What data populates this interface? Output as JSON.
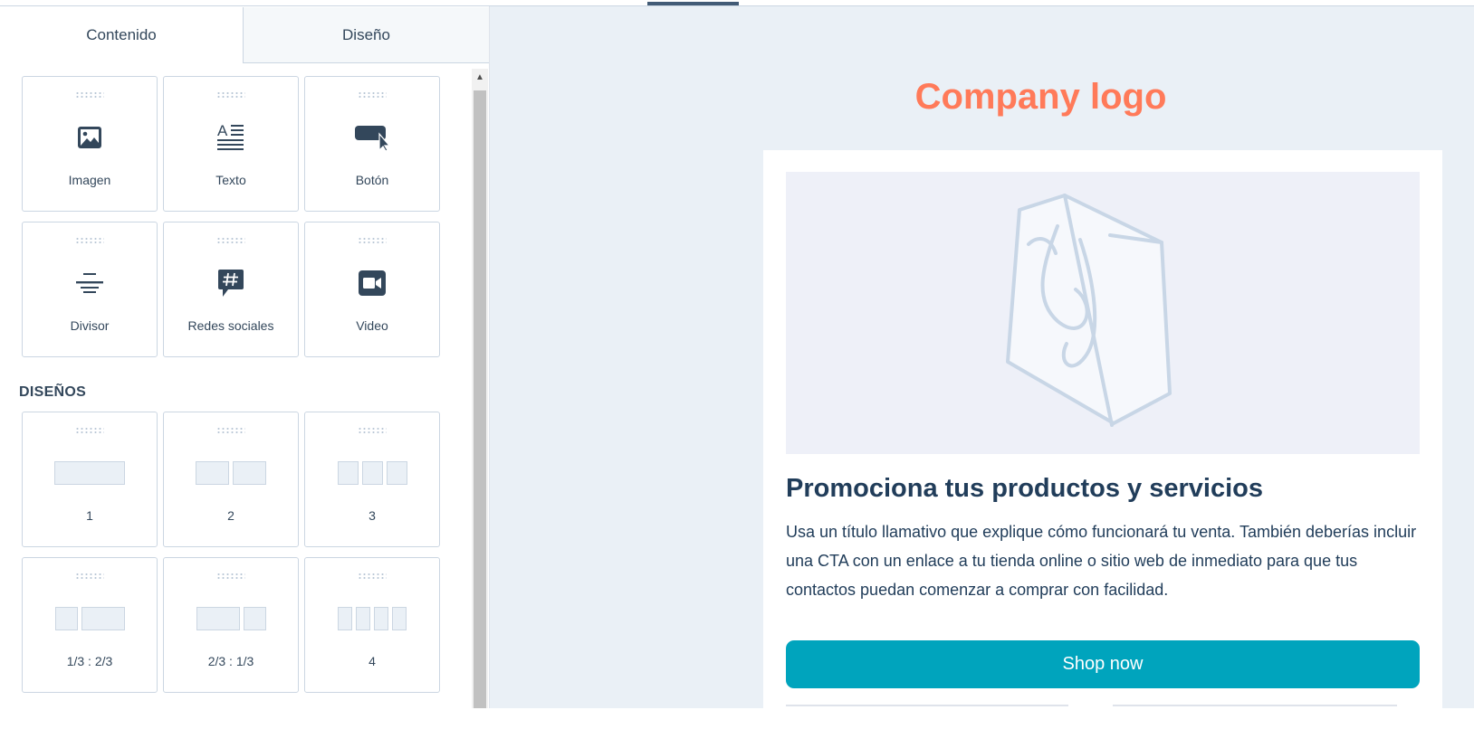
{
  "tabs": {
    "content": "Contenido",
    "design": "Diseño"
  },
  "content_items": [
    {
      "label": "Imagen",
      "icon": "image-icon"
    },
    {
      "label": "Texto",
      "icon": "text-icon"
    },
    {
      "label": "Botón",
      "icon": "button-cursor-icon"
    },
    {
      "label": "Divisor",
      "icon": "divider-icon"
    },
    {
      "label": "Redes sociales",
      "icon": "social-hashtag-icon"
    },
    {
      "label": "Video",
      "icon": "video-camera-icon"
    }
  ],
  "layouts_title": "DISEÑOS",
  "layouts": [
    {
      "label": "1"
    },
    {
      "label": "2"
    },
    {
      "label": "3"
    },
    {
      "label": "1/3 : 2/3"
    },
    {
      "label": "2/3 : 1/3"
    },
    {
      "label": "4"
    }
  ],
  "preview": {
    "logo": "Company logo",
    "headline": "Promociona tus productos y servicios",
    "body": "Usa un título llamativo que explique cómo funcionará tu venta. También deberías incluir una CTA con un enlace a tu tienda online o sitio web de inmediato para que tus contactos puedan comenzar a comprar con facilidad.",
    "cta": "Shop now"
  },
  "colors": {
    "accent_logo": "#ff7a59",
    "cta_background": "#00a4bd",
    "text_dark": "#213d5a",
    "icon": "#33475b"
  }
}
